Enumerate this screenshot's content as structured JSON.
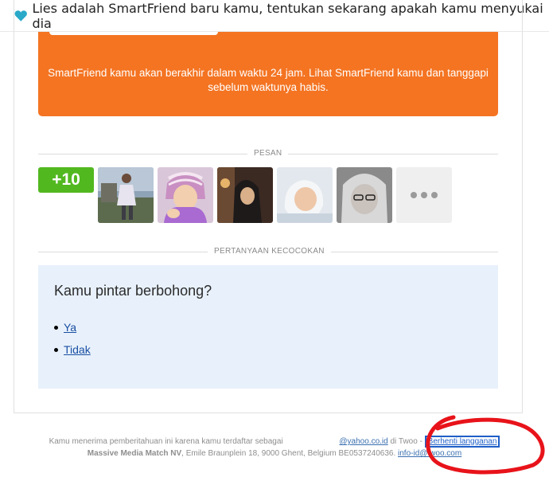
{
  "subject": {
    "icon": "heart-icon",
    "text": "Lies adalah SmartFriend baru kamu, tentukan sekarang apakah kamu menyukai dia"
  },
  "banner": {
    "text": "SmartFriend kamu akan berakhir dalam waktu 24 jam. Lihat SmartFriend kamu dan tanggapi sebelum waktunya habis.",
    "color": "#f47422"
  },
  "messages": {
    "section_label": "PESAN",
    "count_badge": "+10",
    "badge_color": "#52b820",
    "more_icon": "more-dots-icon"
  },
  "match_questions": {
    "section_label": "PERTANYAAN KECOCOKAN",
    "question": "Kamu pintar berbohong?",
    "answers": [
      "Ya",
      "Tidak"
    ]
  },
  "footer": {
    "line1_prefix": "Kamu menerima pemberitahuan ini karena kamu terdaftar sebagai",
    "line1_email": "@yahoo.co.id",
    "line1_middle": "di Twoo -",
    "unsubscribe": "Berhenti langganan",
    "company": "Massive Media Match NV",
    "address": ", Emile Braunplein 18, 9000 Ghent, Belgium BE0537240636.",
    "contact_email": "info-id@twoo.com"
  }
}
